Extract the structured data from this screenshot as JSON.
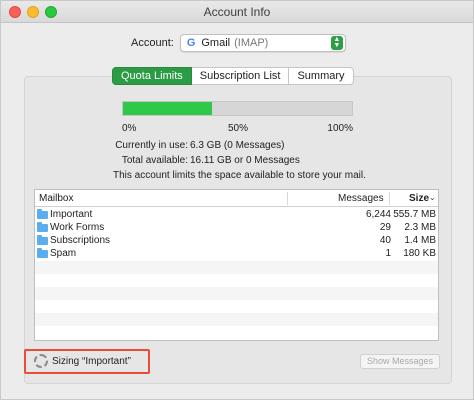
{
  "window": {
    "title": "Account Info"
  },
  "account": {
    "label": "Account:",
    "name": "Gmail",
    "type": "(IMAP)",
    "icon": "google-icon",
    "icon_glyph": "G"
  },
  "tabs": [
    {
      "label": "Quota Limits",
      "active": true
    },
    {
      "label": "Subscription List",
      "active": false
    },
    {
      "label": "Summary",
      "active": false
    }
  ],
  "quota": {
    "used_fraction": 0.39,
    "ticks": [
      "0%",
      "50%",
      "100%"
    ],
    "used_label": "Currently in use:",
    "used_value": "6.3 GB (0 Messages)",
    "total_label": "Total available:",
    "total_value": "16.11 GB or 0 Messages",
    "note": "This account limits the space available to store your mail.",
    "fill_color": "#30c84a"
  },
  "table": {
    "columns": {
      "mailbox": "Mailbox",
      "messages": "Messages",
      "size": "Size"
    },
    "sort_indicator": "⌄",
    "rows": [
      {
        "name": "Important",
        "messages": "6,244",
        "size": "555.7 MB"
      },
      {
        "name": "Work Forms",
        "messages": "29",
        "size": "2.3 MB"
      },
      {
        "name": "Subscriptions",
        "messages": "40",
        "size": "1.4 MB"
      },
      {
        "name": "Spam",
        "messages": "1",
        "size": "180 KB"
      }
    ]
  },
  "status": {
    "text": "Sizing “Important”"
  },
  "buttons": {
    "show_messages": "Show Messages"
  }
}
